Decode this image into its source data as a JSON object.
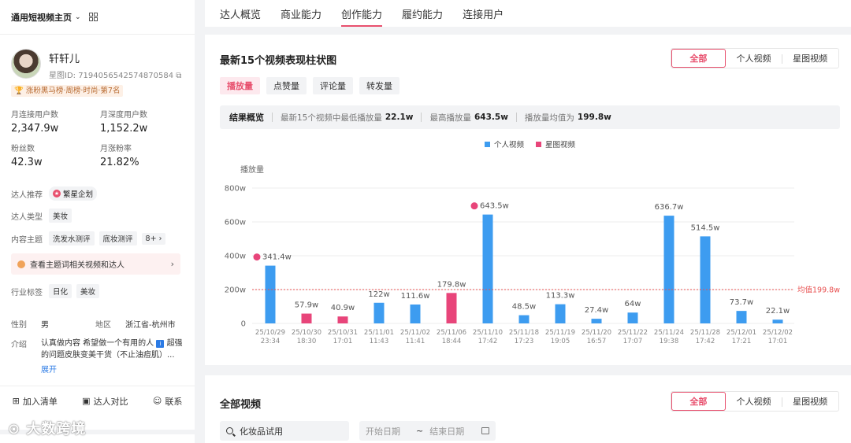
{
  "sidebar": {
    "page_switch": "通用短视频主页",
    "name": "轩轩儿",
    "star_id": "星图ID: 7194056542574870584",
    "rank_badge": "涨粉黑马榜·周榜·时尚·第7名",
    "stats": [
      {
        "label": "月连接用户数",
        "value": "2,347.9w"
      },
      {
        "label": "月深度用户数",
        "value": "1,152.2w"
      },
      {
        "label": "粉丝数",
        "value": "42.3w"
      },
      {
        "label": "月涨粉率",
        "value": "21.82%"
      }
    ],
    "recommend_label": "达人推荐",
    "recommend_value": "繁星企划",
    "type_label": "达人类型",
    "type_value": "美妆",
    "topic_label": "内容主题",
    "topics": [
      "洗发水测评",
      "底妆测评",
      "8+"
    ],
    "topic_banner": "查看主题词相关视频和达人",
    "industry_label": "行业标签",
    "industries": [
      "日化",
      "美妆"
    ],
    "gender_label": "性别",
    "gender_value": "男",
    "region_label": "地区",
    "region_value": "浙江省-杭州市",
    "intro_label": "介绍",
    "intro_text_1": "认真做内容 希望做一个有用的人",
    "intro_text_2": "超强的问题皮肤变美干货（不止油痘肌）...",
    "expand": "展开",
    "actions": [
      "加入清单",
      "达人对比",
      "联系"
    ],
    "logo_text": "大数跨境"
  },
  "topnav": {
    "tabs": [
      "达人概览",
      "商业能力",
      "创作能力",
      "履约能力",
      "连接用户"
    ],
    "active_index": 2
  },
  "chart_card": {
    "title": "最新15个视频表现柱状图",
    "segment": [
      "全部",
      "个人视频",
      "星图视频"
    ],
    "metrics": [
      "播放量",
      "点赞量",
      "评论量",
      "转发量"
    ],
    "summary_head": "结果概览",
    "summary_min_label": "最新15个视频中最低播放量",
    "summary_min_value": "22.1w",
    "summary_max_label": "最高播放量",
    "summary_max_value": "643.5w",
    "summary_avg_label": "播放量均值为",
    "summary_avg_value": "199.8w"
  },
  "chart_data": {
    "type": "bar",
    "ylabel": "播放量",
    "ylim": [
      0,
      800
    ],
    "yticks": [
      "0",
      "200w",
      "400w",
      "600w",
      "800w"
    ],
    "legend": [
      "个人视频",
      "星图视频"
    ],
    "colors": {
      "个人视频": "#3d9cf0",
      "星图视频": "#e8457a",
      "avg": "#e85050"
    },
    "average": 199.8,
    "average_label": "均值199.8w",
    "categories": [
      [
        "25/10/29",
        "23:34"
      ],
      [
        "25/10/30",
        "18:30"
      ],
      [
        "25/10/31",
        "17:01"
      ],
      [
        "25/11/01",
        "11:43"
      ],
      [
        "25/11/02",
        "11:41"
      ],
      [
        "25/11/06",
        "18:44"
      ],
      [
        "25/11/10",
        "17:42"
      ],
      [
        "25/11/18",
        "17:23"
      ],
      [
        "25/11/19",
        "19:05"
      ],
      [
        "25/11/20",
        "16:57"
      ],
      [
        "25/11/22",
        "17:07"
      ],
      [
        "25/11/24",
        "19:38"
      ],
      [
        "25/11/28",
        "17:42"
      ],
      [
        "25/12/01",
        "17:21"
      ],
      [
        "25/12/02",
        "17:01"
      ]
    ],
    "values": [
      341.4,
      57.9,
      40.9,
      122,
      111.6,
      179.8,
      643.5,
      48.5,
      113.3,
      27.4,
      64,
      636.7,
      514.5,
      73.7,
      22.1
    ],
    "value_labels": [
      "341.4w",
      "57.9w",
      "40.9w",
      "122w",
      "111.6w",
      "179.8w",
      "643.5w",
      "48.5w",
      "113.3w",
      "27.4w",
      "64w",
      "636.7w",
      "514.5w",
      "73.7w",
      "22.1w"
    ],
    "series_type": [
      "个人视频",
      "星图视频",
      "星图视频",
      "个人视频",
      "个人视频",
      "星图视频",
      "个人视频",
      "个人视频",
      "个人视频",
      "个人视频",
      "个人视频",
      "个人视频",
      "个人视频",
      "个人视频",
      "个人视频"
    ],
    "flagged": [
      true,
      false,
      false,
      false,
      false,
      false,
      true,
      false,
      false,
      false,
      false,
      false,
      false,
      false,
      false
    ]
  },
  "videos_card": {
    "title": "全部视频",
    "segment": [
      "全部",
      "个人视频",
      "星图视频"
    ],
    "search_value": "化妆品试用",
    "start_placeholder": "开始日期",
    "range_sep": "~",
    "end_placeholder": "结束日期"
  }
}
